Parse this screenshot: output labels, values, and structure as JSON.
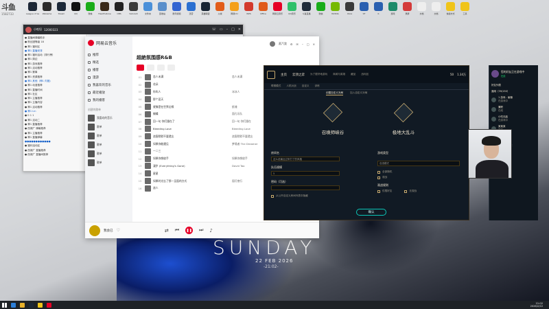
{
  "overlay": {
    "site": "斗鱼",
    "room_number": "1582733"
  },
  "desktop_icons": [
    {
      "label": "League of Legends",
      "color": "#1c2736"
    },
    {
      "label": "WeGame",
      "color": "#2b2b2b"
    },
    {
      "label": "Steam",
      "color": "#1b2838"
    },
    {
      "label": "QQ",
      "color": "#111111"
    },
    {
      "label": "微信",
      "color": "#1aad19"
    },
    {
      "label": "Hearthstone",
      "color": "#3a2a1a"
    },
    {
      "label": "OBS",
      "color": "#222222"
    },
    {
      "label": "Valorant",
      "color": "#3a3a3a"
    },
    {
      "label": "文件夹",
      "color": "#4a90d9"
    },
    {
      "label": "回收站",
      "color": "#5a8fcb"
    },
    {
      "label": "腾讯视频",
      "color": "#3264d1"
    },
    {
      "label": "迅雷",
      "color": "#2a6fd1"
    },
    {
      "label": "英雄联盟",
      "color": "#182433"
    },
    {
      "label": "火绒",
      "color": "#e25c1a"
    },
    {
      "label": "网易UU",
      "color": "#f4a01a"
    },
    {
      "label": "WPS",
      "color": "#d33a2c"
    },
    {
      "label": "Office",
      "color": "#e05a1a"
    },
    {
      "label": "网易云音乐",
      "color": "#e60026"
    },
    {
      "label": "QQ音乐",
      "color": "#30c06a"
    },
    {
      "label": "斗鱼直播",
      "color": "#1f2b3a"
    },
    {
      "label": "微信",
      "color": "#1aad19"
    },
    {
      "label": "NVIDIA",
      "color": "#76b900"
    },
    {
      "label": "Xbox",
      "color": "#3a3a3a"
    },
    {
      "label": "SF",
      "color": "#2a5fb0"
    },
    {
      "label": "K",
      "color": "#2a5fb0"
    },
    {
      "label": "游戏",
      "color": "#1e8a6a"
    },
    {
      "label": "录屏",
      "color": "#d43a3a"
    },
    {
      "label": "文档",
      "color": "#eeeeee"
    },
    {
      "label": "文档",
      "color": "#eeeeee"
    },
    {
      "label": "快捷方式",
      "color": "#f0c419"
    },
    {
      "label": "工具",
      "color": "#f0c419"
    }
  ],
  "chat_window": {
    "title": "小吃坦",
    "room_id": "12000323",
    "rows": [
      "● 直播间弹幕助手",
      "● 粉丝团等级 18",
      "● 神1 福利区",
      "● 神1 直播安排",
      "● 神1 福利活动（排行榜）",
      "● 神1 周边",
      "● 神1 游戏推荐",
      "● 神1 活动推荐",
      "● 神1 赛事",
      "● 神1 资源推荐",
      "● 神1 其他（神1 内推)",
      "● 神1 动漫推荐",
      "● 神1 直播时间",
      "● 神1 社区",
      "● 神1 主播推荐",
      "● 神1 主播内容",
      "● 神1 活动推荐",
      "● 神1 Lin",
      "● 0 1 1",
      "● 神1 活动二",
      "● 神1 直播推荐",
      "● 西湖广 弹幕推荐",
      "● 神1 主播推荐",
      "● 神1 直播弹幕",
      "●●●●●●●●●●●●",
      "● 福利活动区",
      "● 西湖广 直播推荐",
      "● 西湖广 直播间推荐"
    ]
  },
  "music": {
    "app_name": "网易云音乐",
    "nav": [
      "推荐",
      "精选",
      "播客",
      "漫游",
      "我喜欢的音乐",
      "最近播放",
      "我的播客"
    ],
    "section_created": "创建的歌单",
    "playlists": [
      "我喜欢的音乐",
      "歌单",
      "歌单",
      "歌单",
      "歌单",
      "歌单"
    ],
    "user": "蒸汽我",
    "playlist_title": "超絶氛围感R&B",
    "tracks": [
      {
        "n": "01",
        "name": "恋人未满",
        "artist": "恋人未满"
      },
      {
        "n": "02",
        "name": "花朵",
        "artist": ""
      },
      {
        "n": "03",
        "name": "你叫人",
        "artist": "冰冰人"
      },
      {
        "n": "04",
        "name": "那个夏天",
        "artist": ""
      },
      {
        "n": "05",
        "name": "就像是在世界边缘",
        "artist": "纸魂"
      },
      {
        "n": "06",
        "name": "蝴蝶",
        "artist": "面孔乐队"
      },
      {
        "n": "07",
        "name": "回一句 你们跟在了",
        "artist": "回一句 你们跟在"
      },
      {
        "n": "08",
        "name": "Bleeding Love",
        "artist": "Bleeding Love"
      },
      {
        "n": "09",
        "name": "浪客默默不要遗忘",
        "artist": "浪客默默不要遗忘"
      },
      {
        "n": "10",
        "name": "如果你能遇见",
        "artist": "梦境者 The Dreamer"
      },
      {
        "n": "11",
        "name": "一二三",
        "artist": ""
      },
      {
        "n": "12",
        "name": "如果你想放手",
        "artist": "如果你想放手"
      },
      {
        "n": "13",
        "name": "漫步 (Everything's Gone)",
        "artist": "David Tao"
      },
      {
        "n": "14",
        "name": "星星",
        "artist": ""
      },
      {
        "n": "15",
        "name": "如果时光忘了那一见面的方式",
        "artist": "孤灯夜行"
      },
      {
        "n": "16",
        "name": "浪人",
        "artist": ""
      }
    ],
    "now_playing": "我会已"
  },
  "lol": {
    "nav_home": "主页",
    "nav_tft": "云顶之弈",
    "nav_more": [
      "为了更好地游玩",
      "商城与英雄",
      "藏品",
      "战利品",
      "设置"
    ],
    "currency": [
      "50",
      "1.34万"
    ],
    "tabs": [
      "联赛模式",
      "人机对战",
      "自定义",
      "训练"
    ],
    "subtabs": [
      "创建自定义对局",
      "加入自定义对局"
    ],
    "mode_sr": "召唤师峡谷",
    "mode_aram": "极地大乱斗",
    "form": {
      "room_name_label": "房间名",
      "room_name_value": "这么说最近过来打了的风格",
      "team_size_label": "队伍规模",
      "team_size_value": "5",
      "password_label": "密码（可选）",
      "password_value": "",
      "public_list_label": "从公开自定义房间列表中隐藏"
    },
    "right": {
      "game_type_label": "游戏类型",
      "game_type_value": "自选模式",
      "check1": "全部随机",
      "check2": "观战",
      "spectate_label": "观战规则",
      "spectate_all": "仅限好友",
      "spectate_none": "无观战"
    },
    "confirm": "确认"
  },
  "friends": {
    "me": "您的好友正在游戏中",
    "status": "在线",
    "header": "好友列表",
    "group": "通用（39/150）",
    "list": [
      {
        "name": "1 游戏 - 偷懒",
        "state": "在游戏中"
      },
      {
        "name": "兼职",
        "state": "在线"
      },
      {
        "name": "小吃无敌",
        "state": "在游戏中"
      },
      {
        "name": "某某某",
        "state": "离开"
      },
      {
        "name": "Rancious",
        "state": "在线"
      },
      {
        "name": "1010 一截头",
        "state": "在游戏中"
      },
      {
        "name": "大顺城",
        "state": "离开"
      }
    ]
  },
  "wallpaper": {
    "word": "SUNDAY",
    "date": "22 FEB 2026",
    "time": "-21:02-"
  },
  "taskbar": {
    "time": "21:02",
    "date": "2026/2/22"
  }
}
